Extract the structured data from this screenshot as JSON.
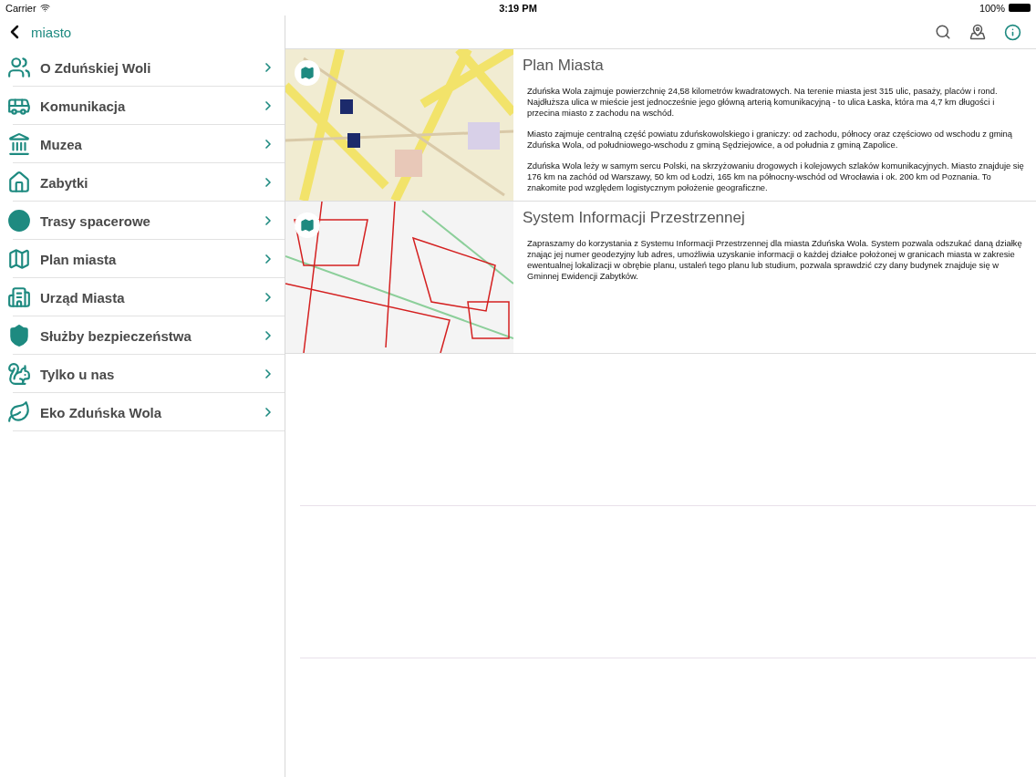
{
  "status_bar": {
    "carrier": "Carrier",
    "time": "3:19 PM",
    "battery": "100%"
  },
  "sidebar": {
    "back_label": "miasto",
    "items": [
      {
        "label": "O Zduńskiej Woli"
      },
      {
        "label": "Komunikacja"
      },
      {
        "label": "Muzea"
      },
      {
        "label": "Zabytki"
      },
      {
        "label": "Trasy spacerowe"
      },
      {
        "label": "Plan miasta"
      },
      {
        "label": "Urząd Miasta"
      },
      {
        "label": "Służby bezpieczeństwa"
      },
      {
        "label": "Tylko u nas"
      },
      {
        "label": "Eko Zduńska Wola"
      }
    ]
  },
  "toolbar": {
    "info_selected": true
  },
  "cards": [
    {
      "kind": "street",
      "title": "Plan Miasta",
      "paragraphs": [
        "Zduńska Wola zajmuje powierzchnię 24,58 kilometrów kwadratowych. Na terenie miasta jest 315 ulic, pasaży, placów i rond. Najdłuższa ulica w mieście jest jednocześnie jego główną arterią komunikacyjną - to ulica Łaska, która ma 4,7 km długości i przecina miasto z zachodu na wschód.",
        "Miasto zajmuje centralną część powiatu zduńskowolskiego i graniczy: od zachodu, północy oraz częściowo od wschodu z gminą Zduńska Wola, od południowego-wschodu z gminą Sędziejowice, a od południa z gminą Zapolice.",
        "Zduńska Wola leży w samym sercu Polski, na skrzyżowaniu drogowych i kolejowych szlaków komunikacyjnych. Miasto znajduje się 176 km na zachód od Warszawy, 50 km od Łodzi, 165 km na północny-wschód od Wrocławia i ok. 200 km od Poznania. To znakomite pod względem logistycznym położenie geograficzne."
      ]
    },
    {
      "kind": "parcel",
      "title": "System Informacji Przestrzennej",
      "paragraphs": [
        "Zapraszamy do korzystania z Systemu Informacji Przestrzennej dla miasta Zduńska Wola. System pozwala odszukać daną działkę znając jej numer geodezyjny lub adres, umożliwia uzyskanie informacji o każdej działce położonej w granicach miasta w zakresie ewentualnej lokalizacji w obrębie planu, ustaleń tego planu lub studium, pozwala sprawdzić czy dany budynek znajduje się w Gminnej Ewidencji Zabytków."
      ]
    }
  ]
}
